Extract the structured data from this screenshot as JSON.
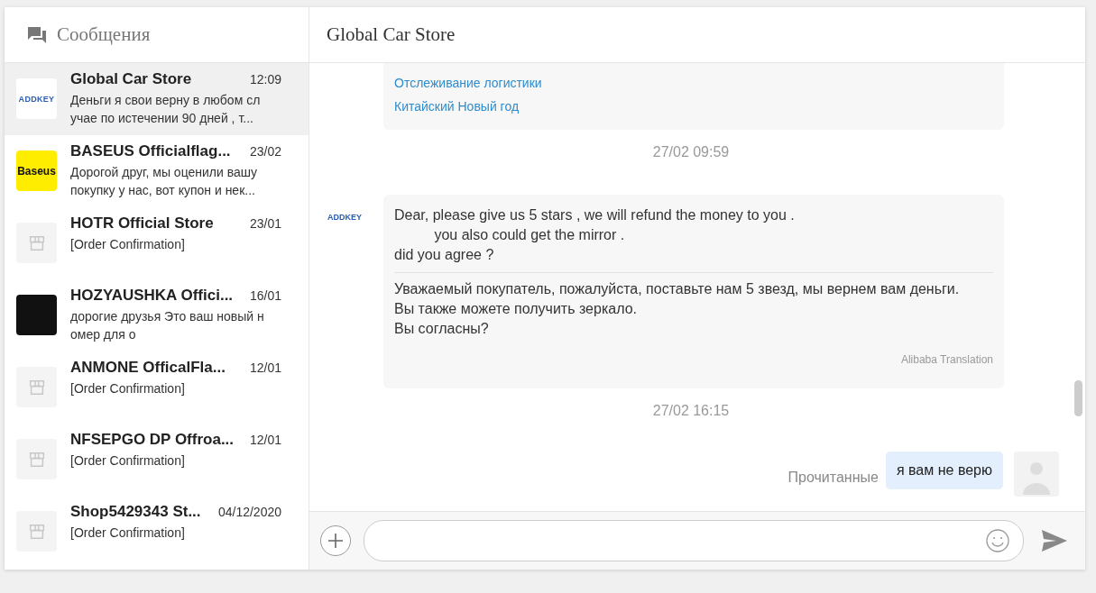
{
  "sidebar": {
    "title": "Сообщения",
    "conversations": [
      {
        "name": "Global Car Store",
        "time": "12:09",
        "preview": "Деньги я свои верну в любом сл учае по истечении 90 дней , т...",
        "avatar": {
          "kind": "logo",
          "logo_text": "ADDKEY",
          "color": "#ffffff"
        },
        "selected": true
      },
      {
        "name": "BASEUS Officialflag...",
        "time": "23/02",
        "preview": "Дорогой друг, мы оценили вашу покупку у нас, вот купон и нек...",
        "avatar": {
          "kind": "logo",
          "logo_text": "Baseus",
          "color": "#ffed00"
        },
        "selected": false
      },
      {
        "name": "HOTR Official Store",
        "time": "23/01",
        "preview": "[Order Confirmation]",
        "avatar": {
          "kind": "store"
        },
        "selected": false
      },
      {
        "name": "HOZYAUSHKA Offici...",
        "time": "16/01",
        "preview": "дорогие друзья Это ваш новый н омер для о",
        "avatar": {
          "kind": "photo"
        },
        "selected": false
      },
      {
        "name": "ANMONE OfficalFla...",
        "time": "12/01",
        "preview": "[Order Confirmation]",
        "avatar": {
          "kind": "store"
        },
        "selected": false
      },
      {
        "name": "NFSEPGO DP Offroa...",
        "time": "12/01",
        "preview": "[Order Confirmation]",
        "avatar": {
          "kind": "store"
        },
        "selected": false
      },
      {
        "name": "Shop5429343 St...",
        "time": "04/12/2020",
        "preview": "[Order Confirmation]",
        "avatar": {
          "kind": "store"
        },
        "selected": false
      }
    ]
  },
  "chat": {
    "title": "Global Car Store",
    "messages": [
      {
        "kind": "links",
        "links": [
          "Отслеживание логистики",
          "Китайский Новый год"
        ]
      },
      {
        "kind": "timestamp",
        "text": "27/02 09:59"
      },
      {
        "kind": "incoming",
        "sender_logo": "ADDKEY",
        "text": "Dear, please give us 5 stars , we will refund the money to you .\n          you also could get the mirror .\ndid you agree ?",
        "translation": "Уважаемый покупатель, пожалуйста, поставьте нам 5 звезд, мы вернем вам деньги.\nВы также можете получить зеркало.\nВы согласны?",
        "translation_credit": "Alibaba Translation"
      },
      {
        "kind": "timestamp",
        "text": "27/02 16:15"
      },
      {
        "kind": "outgoing",
        "text": "я вам не верю",
        "status": "Прочитанные"
      }
    ]
  }
}
